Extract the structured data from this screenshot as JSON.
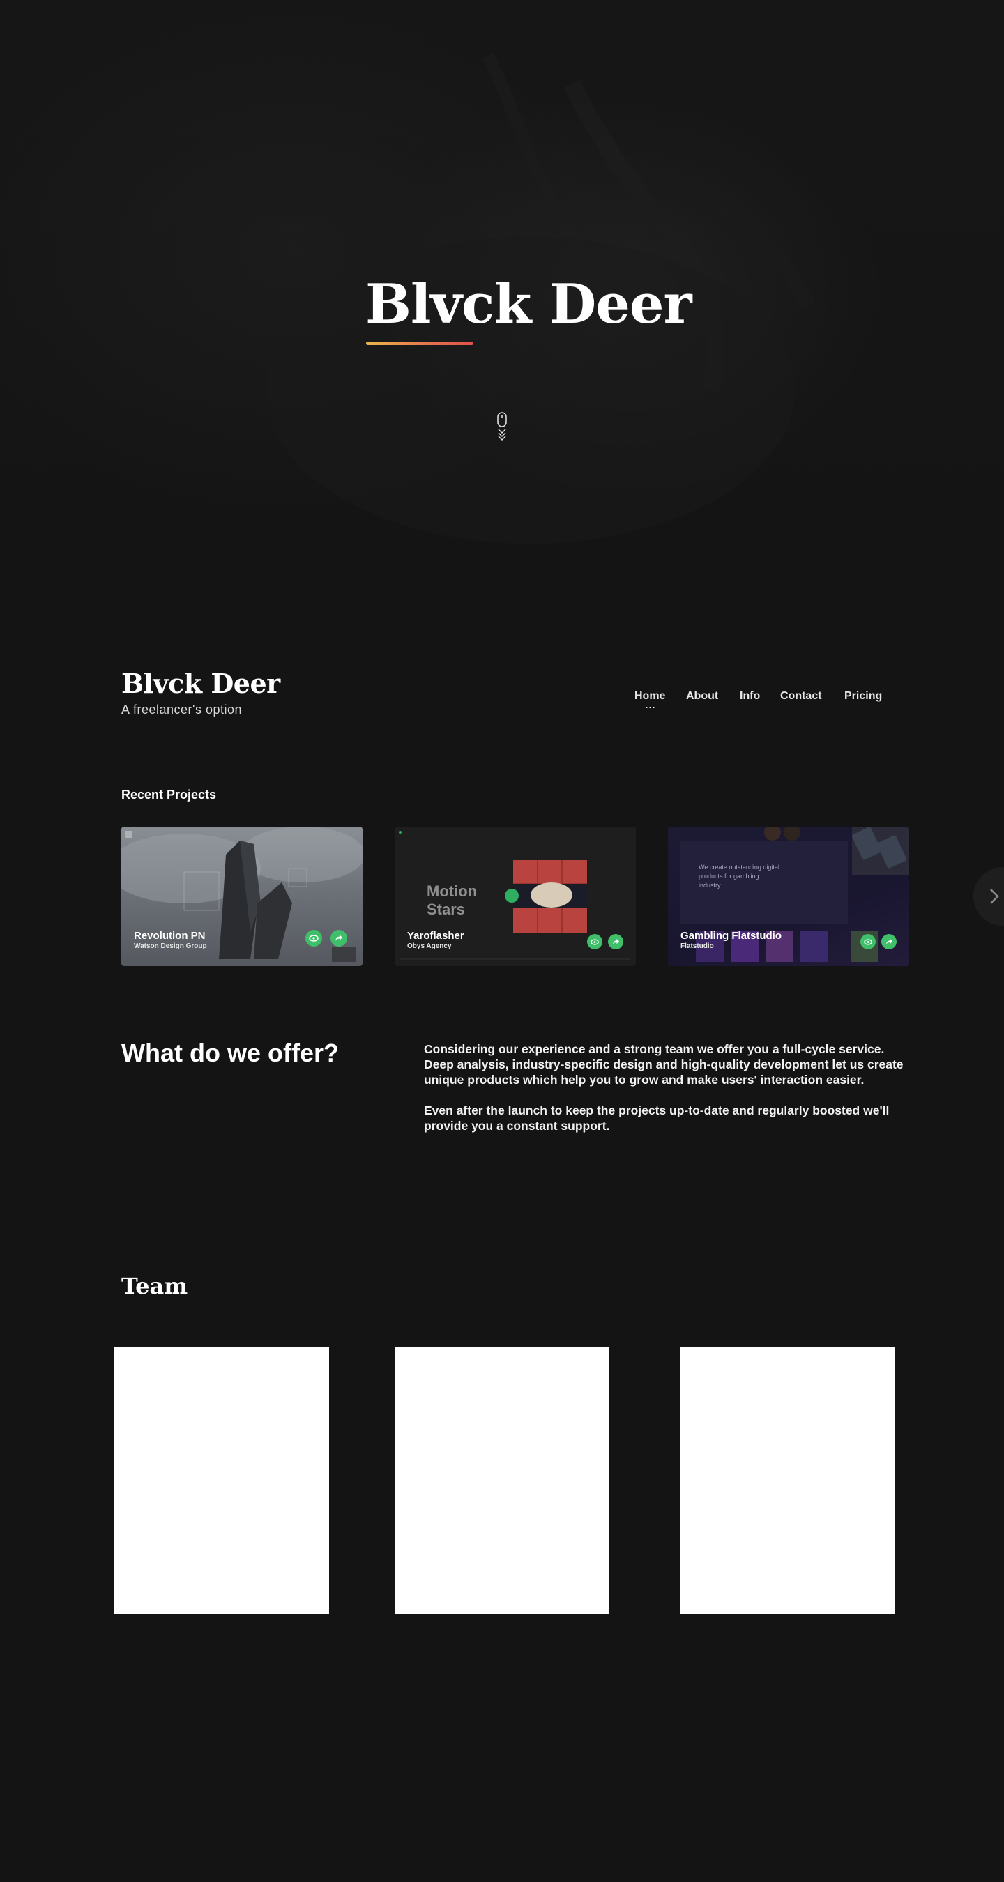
{
  "hero": {
    "title": "Blvck Deer",
    "scroll_icon": "mouse-scroll-icon"
  },
  "header": {
    "brand_title": "Blvck Deer",
    "brand_subtitle": "A freelancer's option",
    "nav": [
      {
        "label": "Home",
        "active": true
      },
      {
        "label": "About",
        "active": false
      },
      {
        "label": "Info",
        "active": false
      },
      {
        "label": "Contact",
        "active": false
      },
      {
        "label": "Pricing",
        "active": false
      }
    ]
  },
  "projects": {
    "label": "Recent Projects",
    "items": [
      {
        "title": "Revolution PN",
        "client": "Watson Design Group",
        "actions": [
          "eye-icon",
          "share-icon"
        ]
      },
      {
        "title": "Yaroflasher",
        "client": "Obys Agency",
        "preview_text": "Motion Stars",
        "actions": [
          "eye-icon",
          "share-icon"
        ]
      },
      {
        "title": "Gambling Flatstudio",
        "client": "Flatstudio",
        "preview_text": "We create outstanding digital products for gambling industry",
        "actions": [
          "eye-icon",
          "share-icon"
        ]
      }
    ],
    "next_icon": "chevron-right-icon"
  },
  "offer": {
    "title": "What do we offer?",
    "paragraph_1": "Considering our experience and a strong team we offer you a full-cycle service. Deep analysis, industry-specific design and high-quality development let us create unique products which help you to grow and make users' interaction easier.",
    "paragraph_2": "Even after the launch to keep the projects up-to-date and regularly boosted we'll provide you a constant support."
  },
  "team": {
    "title": "Team",
    "members": [
      {},
      {},
      {}
    ]
  },
  "colors": {
    "background": "#141414",
    "accent_green": "#3fbf6a",
    "underline_start": "#e8b84a",
    "underline_end": "#e0504e"
  }
}
